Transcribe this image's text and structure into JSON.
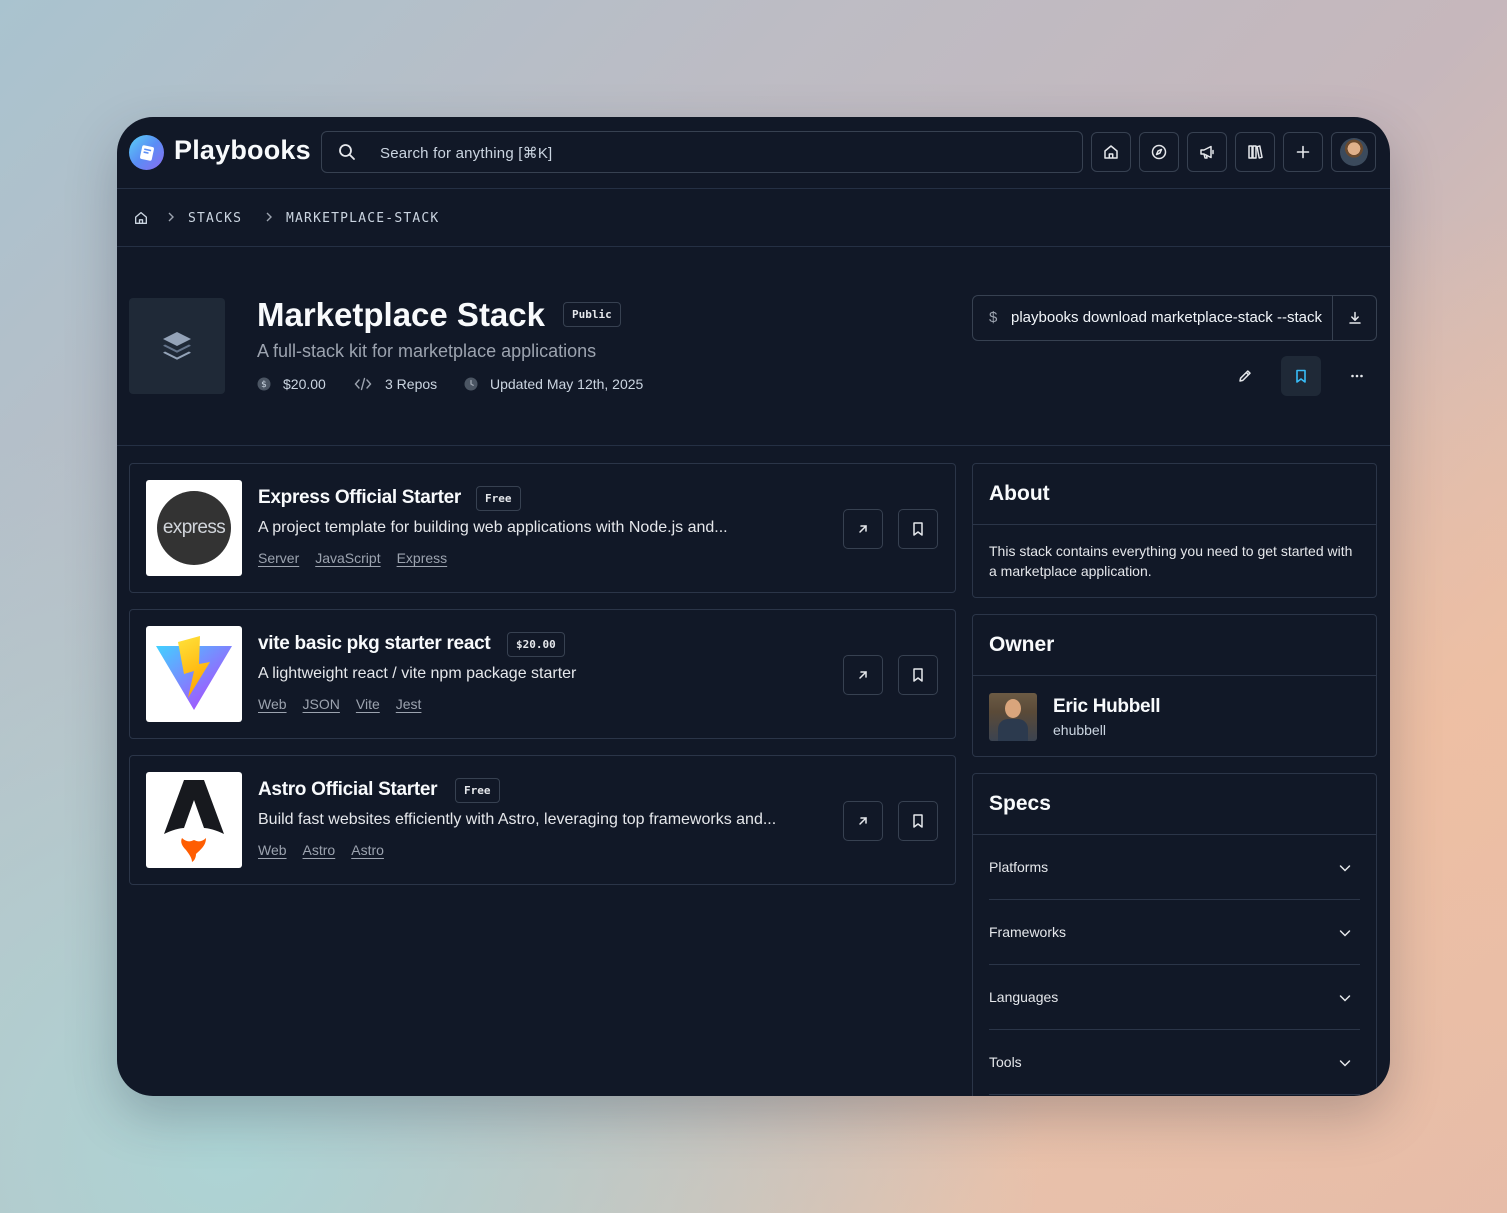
{
  "app": {
    "name": "Playbooks"
  },
  "search": {
    "placeholder": "Search for anything [⌘K]"
  },
  "nav_icons": [
    "home-icon",
    "compass-icon",
    "megaphone-icon",
    "library-icon",
    "plus-icon"
  ],
  "breadcrumb": {
    "items": [
      "STACKS",
      "MARKETPLACE-STACK"
    ]
  },
  "stack": {
    "title": "Marketplace Stack",
    "visibility": "Public",
    "subtitle": "A full-stack kit for marketplace applications",
    "price": "$20.00",
    "repos": "3 Repos",
    "updated": "Updated May 12th, 2025",
    "command_prefix": "$",
    "command": "playbooks download marketplace-stack --stack"
  },
  "repos": [
    {
      "name": "Express Official Starter",
      "badge": "Free",
      "description": "A project template for building web applications with Node.js and...",
      "tags": [
        "Server",
        "JavaScript",
        "Express"
      ],
      "logo_text": "express"
    },
    {
      "name": "vite basic pkg starter react",
      "badge": "$20.00",
      "description": "A lightweight react / vite npm package starter",
      "tags": [
        "Web",
        "JSON",
        "Vite",
        "Jest"
      ]
    },
    {
      "name": "Astro Official Starter",
      "badge": "Free",
      "description": "Build fast websites efficiently with Astro, leveraging top frameworks and...",
      "tags": [
        "Web",
        "Astro",
        "Astro"
      ]
    }
  ],
  "about": {
    "title": "About",
    "text": "This stack contains everything you need to get started with a marketplace application."
  },
  "owner": {
    "title": "Owner",
    "name": "Eric Hubbell",
    "username": "ehubbell"
  },
  "specs": {
    "title": "Specs",
    "items": [
      "Platforms",
      "Frameworks",
      "Languages",
      "Tools"
    ]
  },
  "colors": {
    "window_bg": "#111827",
    "border": "#374151",
    "accent": "#38bdf8"
  }
}
